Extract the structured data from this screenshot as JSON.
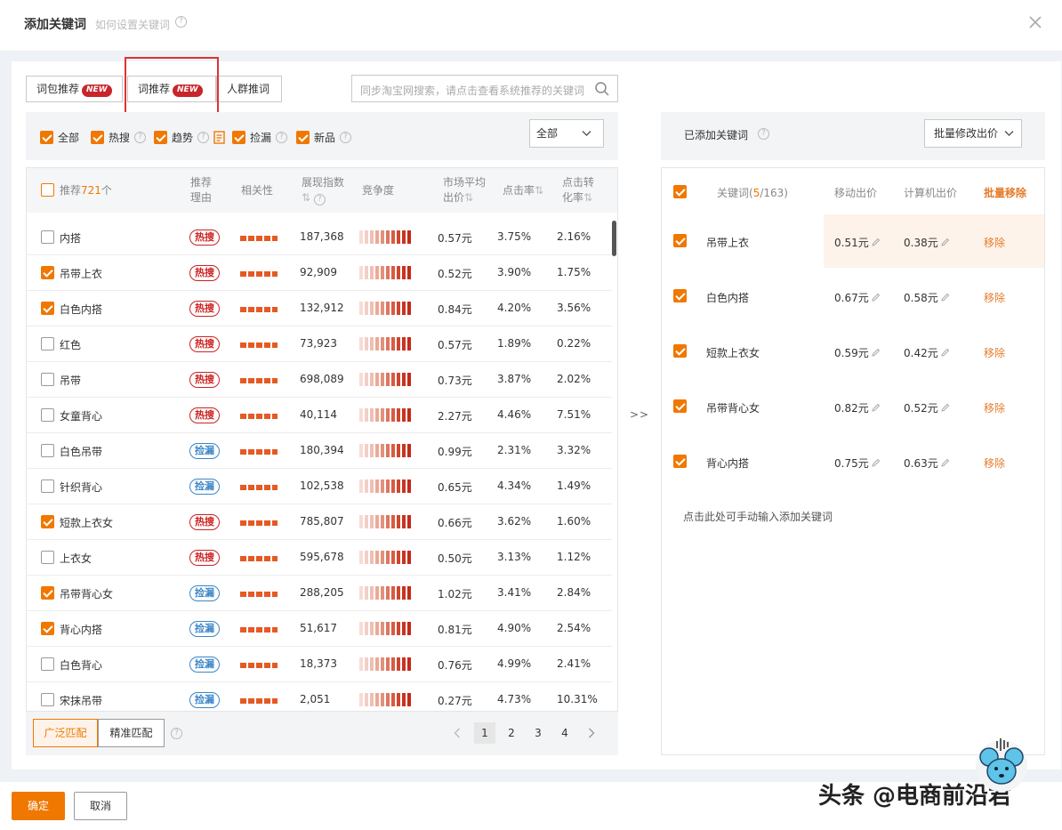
{
  "dialog": {
    "title": "添加关键词",
    "subtitle": "如何设置关键词",
    "help_icon": "question-circle-icon",
    "close_icon": "close-icon"
  },
  "tabs": [
    {
      "label": "词包推荐",
      "badge": "NEW"
    },
    {
      "label": "词推荐",
      "badge": "NEW"
    },
    {
      "label": "人群推词",
      "badge": ""
    }
  ],
  "search": {
    "placeholder": "同步淘宝网搜索，请点击查看系统推荐的关键词",
    "icon": "search-icon"
  },
  "filters": {
    "items": [
      {
        "label": "全部",
        "checked": true
      },
      {
        "label": "热搜",
        "checked": true
      },
      {
        "label": "趋势",
        "checked": true
      },
      {
        "label": "捡漏",
        "checked": true
      },
      {
        "label": "新品",
        "checked": true
      }
    ],
    "select_value": "全部"
  },
  "table": {
    "header": {
      "recommend_prefix": "推荐",
      "recommend_count": "721",
      "recommend_suffix": "个",
      "reason_line1": "推荐",
      "reason_line2": "理由",
      "relevance": "相关性",
      "impressions": "展现指数",
      "competition": "竞争度",
      "avg_bid_line1": "市场平均",
      "avg_bid_line2": "出价",
      "ctr": "点击率",
      "cvr_line1": "点击转",
      "cvr_line2": "化率",
      "sort_icon": "sort-arrows-icon"
    },
    "rows": [
      {
        "keyword": "内搭",
        "checked": false,
        "tag": "热搜",
        "tag_type": "hot",
        "impressions": "187,368",
        "bid": "0.57元",
        "ctr": "3.75%",
        "cvr": "2.16%"
      },
      {
        "keyword": "吊带上衣",
        "checked": true,
        "tag": "热搜",
        "tag_type": "hot",
        "impressions": "92,909",
        "bid": "0.52元",
        "ctr": "3.90%",
        "cvr": "1.75%"
      },
      {
        "keyword": "白色内搭",
        "checked": true,
        "tag": "热搜",
        "tag_type": "hot",
        "impressions": "132,912",
        "bid": "0.84元",
        "ctr": "4.20%",
        "cvr": "3.56%"
      },
      {
        "keyword": "红色",
        "checked": false,
        "tag": "热搜",
        "tag_type": "hot",
        "impressions": "73,923",
        "bid": "0.57元",
        "ctr": "1.89%",
        "cvr": "0.22%"
      },
      {
        "keyword": "吊带",
        "checked": false,
        "tag": "热搜",
        "tag_type": "hot",
        "impressions": "698,089",
        "bid": "0.73元",
        "ctr": "3.87%",
        "cvr": "2.02%"
      },
      {
        "keyword": "女童背心",
        "checked": false,
        "tag": "热搜",
        "tag_type": "hot",
        "impressions": "40,114",
        "bid": "2.27元",
        "ctr": "4.46%",
        "cvr": "7.51%"
      },
      {
        "keyword": "白色吊带",
        "checked": false,
        "tag": "捡漏",
        "tag_type": "miss",
        "impressions": "180,394",
        "bid": "0.99元",
        "ctr": "2.31%",
        "cvr": "3.32%"
      },
      {
        "keyword": "针织背心",
        "checked": false,
        "tag": "捡漏",
        "tag_type": "miss",
        "impressions": "102,538",
        "bid": "0.65元",
        "ctr": "4.34%",
        "cvr": "1.49%"
      },
      {
        "keyword": "短款上衣女",
        "checked": true,
        "tag": "热搜",
        "tag_type": "hot",
        "impressions": "785,807",
        "bid": "0.66元",
        "ctr": "3.62%",
        "cvr": "1.60%"
      },
      {
        "keyword": "上衣女",
        "checked": false,
        "tag": "热搜",
        "tag_type": "hot",
        "impressions": "595,678",
        "bid": "0.50元",
        "ctr": "3.13%",
        "cvr": "1.12%"
      },
      {
        "keyword": "吊带背心女",
        "checked": true,
        "tag": "捡漏",
        "tag_type": "miss",
        "impressions": "288,205",
        "bid": "1.02元",
        "ctr": "3.41%",
        "cvr": "2.84%"
      },
      {
        "keyword": "背心内搭",
        "checked": true,
        "tag": "捡漏",
        "tag_type": "miss",
        "impressions": "51,617",
        "bid": "0.81元",
        "ctr": "4.90%",
        "cvr": "2.54%"
      },
      {
        "keyword": "白色背心",
        "checked": false,
        "tag": "捡漏",
        "tag_type": "miss",
        "impressions": "18,373",
        "bid": "0.76元",
        "ctr": "4.99%",
        "cvr": "2.41%"
      },
      {
        "keyword": "宋抹吊带",
        "checked": false,
        "tag": "捡漏",
        "tag_type": "miss",
        "impressions": "2,051",
        "bid": "0.27元",
        "ctr": "4.73%",
        "cvr": "10.31%"
      }
    ]
  },
  "match": {
    "broad": "广泛匹配",
    "exact": "精准匹配"
  },
  "pagination": {
    "pages": [
      "1",
      "2",
      "3",
      "4"
    ],
    "current": "1",
    "prev_icon": "chevron-left-icon",
    "next_icon": "chevron-right-icon"
  },
  "transfer_arrows": ">>",
  "right": {
    "title": "已添加关键词",
    "bulk_bid": "批量修改出价",
    "header": {
      "keyword_label": "关键词(",
      "count_added": "5",
      "count_total": "/163)",
      "mobile_bid": "移动出价",
      "pc_bid": "计算机出价",
      "bulk_remove": "批量移除"
    },
    "rows": [
      {
        "keyword": "吊带上衣",
        "mobile": "0.51元",
        "pc": "0.38元",
        "remove": "移除"
      },
      {
        "keyword": "白色内搭",
        "mobile": "0.67元",
        "pc": "0.58元",
        "remove": "移除"
      },
      {
        "keyword": "短款上衣女",
        "mobile": "0.59元",
        "pc": "0.42元",
        "remove": "移除"
      },
      {
        "keyword": "吊带背心女",
        "mobile": "0.82元",
        "pc": "0.52元",
        "remove": "移除"
      },
      {
        "keyword": "背心内搭",
        "mobile": "0.75元",
        "pc": "0.63元",
        "remove": "移除"
      }
    ],
    "manual_hint": "点击此处可手动输入添加关键词"
  },
  "footer": {
    "confirm": "确定",
    "cancel": "取消"
  },
  "watermark": "头条 @电商前沿君",
  "colors": {
    "accent": "#f07800",
    "hot": "#cc2222",
    "miss": "#3a86c8",
    "remove": "#e67b2b",
    "badge": "#c7262b"
  }
}
